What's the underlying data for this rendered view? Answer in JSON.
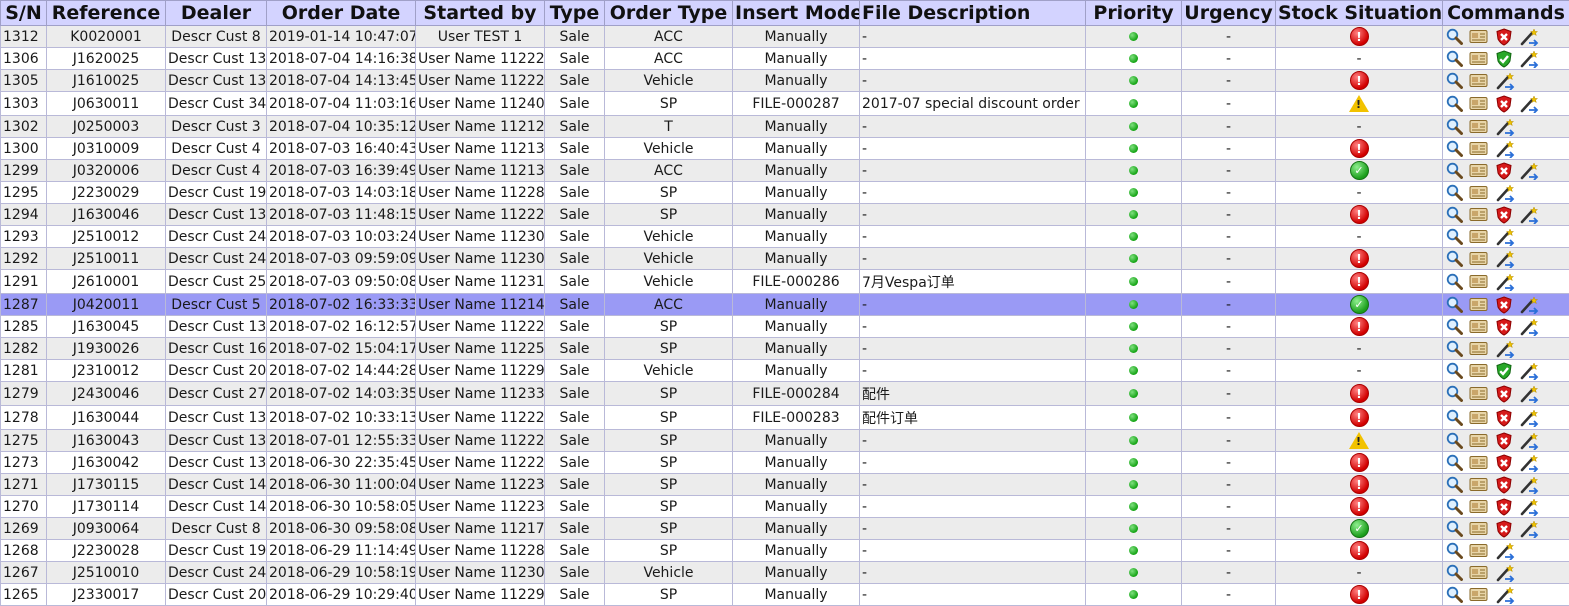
{
  "headers": [
    "S/N",
    "Reference",
    "Dealer",
    "Order Date",
    "Started by",
    "Type",
    "Order Type",
    "Insert Mode",
    "File Description",
    "Priority",
    "Urgency",
    "Stock Situation",
    "Commands"
  ],
  "rows": [
    {
      "sn": "1312",
      "ref": "K0020001",
      "dealer": "Descr Cust 8",
      "date": "2019-01-14 10:47:07",
      "by": "User TEST 1",
      "type": "Sale",
      "otype": "ACC",
      "mode": "Manually",
      "desc": "-",
      "urgency": "-",
      "stock": "error",
      "stock_text": "",
      "cmd3": "reject",
      "selected": false
    },
    {
      "sn": "1306",
      "ref": "J1620025",
      "dealer": "Descr Cust 13",
      "date": "2018-07-04 14:16:38",
      "by": "User Name 11222",
      "type": "Sale",
      "otype": "ACC",
      "mode": "Manually",
      "desc": "-",
      "urgency": "-",
      "stock": "none",
      "stock_text": "-",
      "cmd3": "approve",
      "selected": false
    },
    {
      "sn": "1305",
      "ref": "J1610025",
      "dealer": "Descr Cust 13",
      "date": "2018-07-04 14:13:45",
      "by": "User Name 11222",
      "type": "Sale",
      "otype": "Vehicle",
      "mode": "Manually",
      "desc": "-",
      "urgency": "-",
      "stock": "error",
      "stock_text": "",
      "cmd3": "none",
      "selected": false
    },
    {
      "sn": "1303",
      "ref": "J0630011",
      "dealer": "Descr Cust 34",
      "date": "2018-07-04 11:03:16",
      "by": "User Name 11240",
      "type": "Sale",
      "otype": "SP",
      "mode": "FILE-000287",
      "desc": "2017-07 special discount order",
      "urgency": "-",
      "stock": "warning",
      "stock_text": "",
      "cmd3": "reject",
      "selected": false
    },
    {
      "sn": "1302",
      "ref": "J0250003",
      "dealer": "Descr Cust 3",
      "date": "2018-07-04 10:35:12",
      "by": "User Name 11212",
      "type": "Sale",
      "otype": "T",
      "mode": "Manually",
      "desc": "-",
      "urgency": "-",
      "stock": "none",
      "stock_text": "-",
      "cmd3": "none",
      "selected": false
    },
    {
      "sn": "1300",
      "ref": "J0310009",
      "dealer": "Descr Cust 4",
      "date": "2018-07-03 16:40:43",
      "by": "User Name 11213",
      "type": "Sale",
      "otype": "Vehicle",
      "mode": "Manually",
      "desc": "-",
      "urgency": "-",
      "stock": "error",
      "stock_text": "",
      "cmd3": "none",
      "selected": false
    },
    {
      "sn": "1299",
      "ref": "J0320006",
      "dealer": "Descr Cust 4",
      "date": "2018-07-03 16:39:49",
      "by": "User Name 11213",
      "type": "Sale",
      "otype": "ACC",
      "mode": "Manually",
      "desc": "-",
      "urgency": "-",
      "stock": "ok",
      "stock_text": "",
      "cmd3": "reject",
      "selected": false
    },
    {
      "sn": "1295",
      "ref": "J2230029",
      "dealer": "Descr Cust 19",
      "date": "2018-07-03 14:03:18",
      "by": "User Name 11228",
      "type": "Sale",
      "otype": "SP",
      "mode": "Manually",
      "desc": "-",
      "urgency": "-",
      "stock": "none",
      "stock_text": "-",
      "cmd3": "none",
      "selected": false
    },
    {
      "sn": "1294",
      "ref": "J1630046",
      "dealer": "Descr Cust 13",
      "date": "2018-07-03 11:48:15",
      "by": "User Name 11222",
      "type": "Sale",
      "otype": "SP",
      "mode": "Manually",
      "desc": "-",
      "urgency": "-",
      "stock": "error",
      "stock_text": "",
      "cmd3": "reject",
      "selected": false
    },
    {
      "sn": "1293",
      "ref": "J2510012",
      "dealer": "Descr Cust 24",
      "date": "2018-07-03 10:03:24",
      "by": "User Name 11230",
      "type": "Sale",
      "otype": "Vehicle",
      "mode": "Manually",
      "desc": "-",
      "urgency": "-",
      "stock": "none",
      "stock_text": "-",
      "cmd3": "none",
      "selected": false
    },
    {
      "sn": "1292",
      "ref": "J2510011",
      "dealer": "Descr Cust 24",
      "date": "2018-07-03 09:59:09",
      "by": "User Name 11230",
      "type": "Sale",
      "otype": "Vehicle",
      "mode": "Manually",
      "desc": "-",
      "urgency": "-",
      "stock": "error",
      "stock_text": "",
      "cmd3": "none",
      "selected": false
    },
    {
      "sn": "1291",
      "ref": "J2610001",
      "dealer": "Descr Cust 25",
      "date": "2018-07-03 09:50:08",
      "by": "User Name 11231",
      "type": "Sale",
      "otype": "Vehicle",
      "mode": "FILE-000286",
      "desc": "7月Vespa订单",
      "urgency": "-",
      "stock": "error",
      "stock_text": "",
      "cmd3": "none",
      "selected": false
    },
    {
      "sn": "1287",
      "ref": "J0420011",
      "dealer": "Descr Cust 5",
      "date": "2018-07-02 16:33:33",
      "by": "User Name 11214",
      "type": "Sale",
      "otype": "ACC",
      "mode": "Manually",
      "desc": "-",
      "urgency": "-",
      "stock": "ok",
      "stock_text": "",
      "cmd3": "reject",
      "selected": true
    },
    {
      "sn": "1285",
      "ref": "J1630045",
      "dealer": "Descr Cust 13",
      "date": "2018-07-02 16:12:57",
      "by": "User Name 11222",
      "type": "Sale",
      "otype": "SP",
      "mode": "Manually",
      "desc": "-",
      "urgency": "-",
      "stock": "error",
      "stock_text": "",
      "cmd3": "reject",
      "selected": false
    },
    {
      "sn": "1282",
      "ref": "J1930026",
      "dealer": "Descr Cust 16",
      "date": "2018-07-02 15:04:17",
      "by": "User Name 11225",
      "type": "Sale",
      "otype": "SP",
      "mode": "Manually",
      "desc": "-",
      "urgency": "-",
      "stock": "none",
      "stock_text": "-",
      "cmd3": "none",
      "selected": false
    },
    {
      "sn": "1281",
      "ref": "J2310012",
      "dealer": "Descr Cust 20",
      "date": "2018-07-02 14:44:28",
      "by": "User Name 11229",
      "type": "Sale",
      "otype": "Vehicle",
      "mode": "Manually",
      "desc": "-",
      "urgency": "-",
      "stock": "none",
      "stock_text": "-",
      "cmd3": "approve",
      "selected": false
    },
    {
      "sn": "1279",
      "ref": "J2430046",
      "dealer": "Descr Cust 27",
      "date": "2018-07-02 14:03:35",
      "by": "User Name 11233",
      "type": "Sale",
      "otype": "SP",
      "mode": "FILE-000284",
      "desc": "配件",
      "urgency": "-",
      "stock": "error",
      "stock_text": "",
      "cmd3": "reject",
      "selected": false
    },
    {
      "sn": "1278",
      "ref": "J1630044",
      "dealer": "Descr Cust 13",
      "date": "2018-07-02 10:33:13",
      "by": "User Name 11222",
      "type": "Sale",
      "otype": "SP",
      "mode": "FILE-000283",
      "desc": "配件订单",
      "urgency": "-",
      "stock": "error",
      "stock_text": "",
      "cmd3": "reject",
      "selected": false
    },
    {
      "sn": "1275",
      "ref": "J1630043",
      "dealer": "Descr Cust 13",
      "date": "2018-07-01 12:55:33",
      "by": "User Name 11222",
      "type": "Sale",
      "otype": "SP",
      "mode": "Manually",
      "desc": "-",
      "urgency": "-",
      "stock": "warning",
      "stock_text": "",
      "cmd3": "reject",
      "selected": false
    },
    {
      "sn": "1273",
      "ref": "J1630042",
      "dealer": "Descr Cust 13",
      "date": "2018-06-30 22:35:45",
      "by": "User Name 11222",
      "type": "Sale",
      "otype": "SP",
      "mode": "Manually",
      "desc": "-",
      "urgency": "-",
      "stock": "error",
      "stock_text": "",
      "cmd3": "reject",
      "selected": false
    },
    {
      "sn": "1271",
      "ref": "J1730115",
      "dealer": "Descr Cust 14",
      "date": "2018-06-30 11:00:04",
      "by": "User Name 11223",
      "type": "Sale",
      "otype": "SP",
      "mode": "Manually",
      "desc": "-",
      "urgency": "-",
      "stock": "error",
      "stock_text": "",
      "cmd3": "reject",
      "selected": false
    },
    {
      "sn": "1270",
      "ref": "J1730114",
      "dealer": "Descr Cust 14",
      "date": "2018-06-30 10:58:05",
      "by": "User Name 11223",
      "type": "Sale",
      "otype": "SP",
      "mode": "Manually",
      "desc": "-",
      "urgency": "-",
      "stock": "error",
      "stock_text": "",
      "cmd3": "reject",
      "selected": false
    },
    {
      "sn": "1269",
      "ref": "J0930064",
      "dealer": "Descr Cust 8",
      "date": "2018-06-30 09:58:08",
      "by": "User Name 11217",
      "type": "Sale",
      "otype": "SP",
      "mode": "Manually",
      "desc": "-",
      "urgency": "-",
      "stock": "ok",
      "stock_text": "",
      "cmd3": "reject",
      "selected": false
    },
    {
      "sn": "1268",
      "ref": "J2230028",
      "dealer": "Descr Cust 19",
      "date": "2018-06-29 11:14:49",
      "by": "User Name 11228",
      "type": "Sale",
      "otype": "SP",
      "mode": "Manually",
      "desc": "-",
      "urgency": "-",
      "stock": "error",
      "stock_text": "",
      "cmd3": "none",
      "selected": false
    },
    {
      "sn": "1267",
      "ref": "J2510010",
      "dealer": "Descr Cust 24",
      "date": "2018-06-29 10:58:19",
      "by": "User Name 11230",
      "type": "Sale",
      "otype": "Vehicle",
      "mode": "Manually",
      "desc": "-",
      "urgency": "-",
      "stock": "none",
      "stock_text": "-",
      "cmd3": "none",
      "selected": false
    },
    {
      "sn": "1265",
      "ref": "J2330017",
      "dealer": "Descr Cust 20",
      "date": "2018-06-29 10:29:40",
      "by": "User Name 11229",
      "type": "Sale",
      "otype": "SP",
      "mode": "Manually",
      "desc": "-",
      "urgency": "-",
      "stock": "error",
      "stock_text": "",
      "cmd3": "none",
      "selected": false
    }
  ]
}
